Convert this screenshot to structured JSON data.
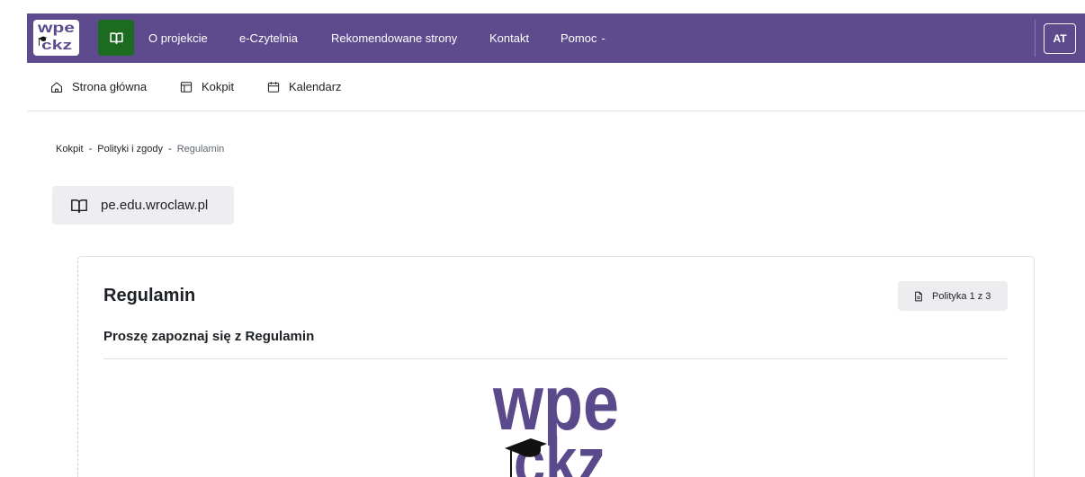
{
  "navbar": {
    "logo": {
      "line1": "wpe",
      "line2": "ckz",
      "icon": "graduation-cap-icon"
    },
    "course_button_icon": "book-icon",
    "links": [
      {
        "label": "O projekcie"
      },
      {
        "label": "e-Czytelnia"
      },
      {
        "label": "Rekomendowane strony"
      },
      {
        "label": "Kontakt"
      },
      {
        "label": "Pomoc",
        "caret": "-"
      }
    ],
    "avatar_initials": "AT"
  },
  "secondary_nav": {
    "items": [
      {
        "label": "Strona główna",
        "icon": "home-icon"
      },
      {
        "label": "Kokpit",
        "icon": "dashboard-icon"
      },
      {
        "label": "Kalendarz",
        "icon": "calendar-icon"
      }
    ]
  },
  "breadcrumb": {
    "separator": "-",
    "items": [
      {
        "label": "Kokpit"
      },
      {
        "label": "Polityki i zgody"
      },
      {
        "label": "Regulamin"
      }
    ]
  },
  "course": {
    "label": "pe.edu.wroclaw.pl",
    "icon": "book-icon"
  },
  "policy": {
    "title": "Regulamin",
    "counter": {
      "label": "Polityka 1 z 3",
      "icon": "document-icon"
    },
    "prompt": "Proszę zapoznaj się z Regulamin",
    "logo": {
      "line1": "wpe",
      "line2": "ckz",
      "icon": "graduation-cap-icon"
    }
  },
  "colors": {
    "brand_purple": "#5d4b8d",
    "course_button_green": "#1d6a21",
    "logo_purple": "#5a4a8c",
    "text": "#1d2125",
    "muted_text": "#5f6770",
    "badge_bg": "#eeedf2"
  }
}
